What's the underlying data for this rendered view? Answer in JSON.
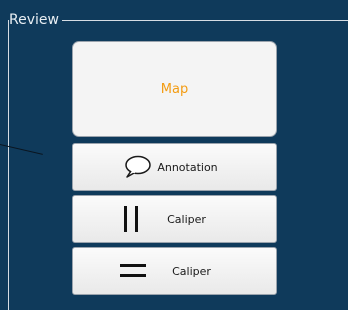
{
  "group": {
    "title": "Review"
  },
  "buttons": {
    "map": {
      "label": "Map",
      "label_color": "#f39c12"
    },
    "annotation": {
      "label": "Annotation",
      "icon": "speech-bubble-icon"
    },
    "caliper_vertical": {
      "label": "Caliper",
      "icon": "vertical-caliper-icon"
    },
    "caliper_horizontal": {
      "label": "Caliper",
      "icon": "horizontal-caliper-icon"
    }
  },
  "colors": {
    "background": "#0f3a5b",
    "border": "#d6dde4",
    "button_face": "#f4f4f4"
  }
}
